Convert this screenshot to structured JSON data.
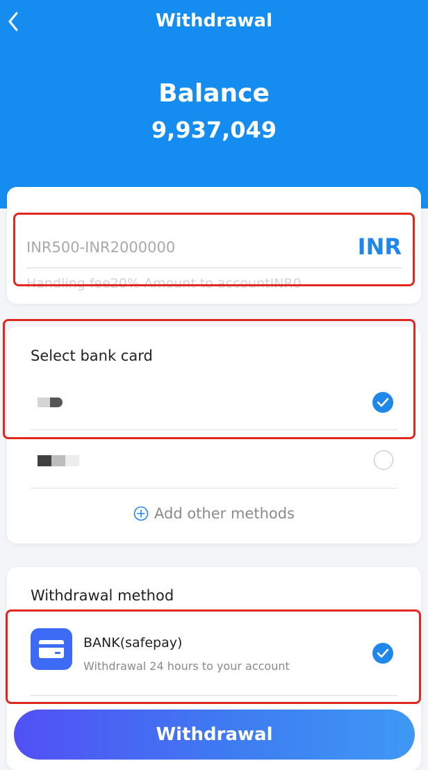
{
  "header": {
    "title": "Withdrawal",
    "balance_label": "Balance",
    "balance_value": "9,937,049",
    "back_icon": "chevron-left-icon"
  },
  "amount": {
    "placeholder": "INR500-INR2000000",
    "currency": "INR",
    "fee_note": "Handling fee20% Amount to accountINR0"
  },
  "bank_cards": {
    "title": "Select bank card",
    "items": [
      {
        "selected": true
      },
      {
        "selected": false
      }
    ],
    "add_label": "Add other methods",
    "add_icon": "plus-circle-icon"
  },
  "withdrawal_method": {
    "title": "Withdrawal method",
    "method_name": "BANK(safepay)",
    "method_desc": "Withdrawal 24 hours to your account",
    "icon": "credit-card-icon",
    "selected": true
  },
  "submit_label": "Withdrawal",
  "colors": {
    "header_bg": "#148cf0",
    "accent": "#1f86ea",
    "highlight": "#e0281f",
    "button_start": "#5250f4",
    "button_end": "#3f98f4"
  }
}
